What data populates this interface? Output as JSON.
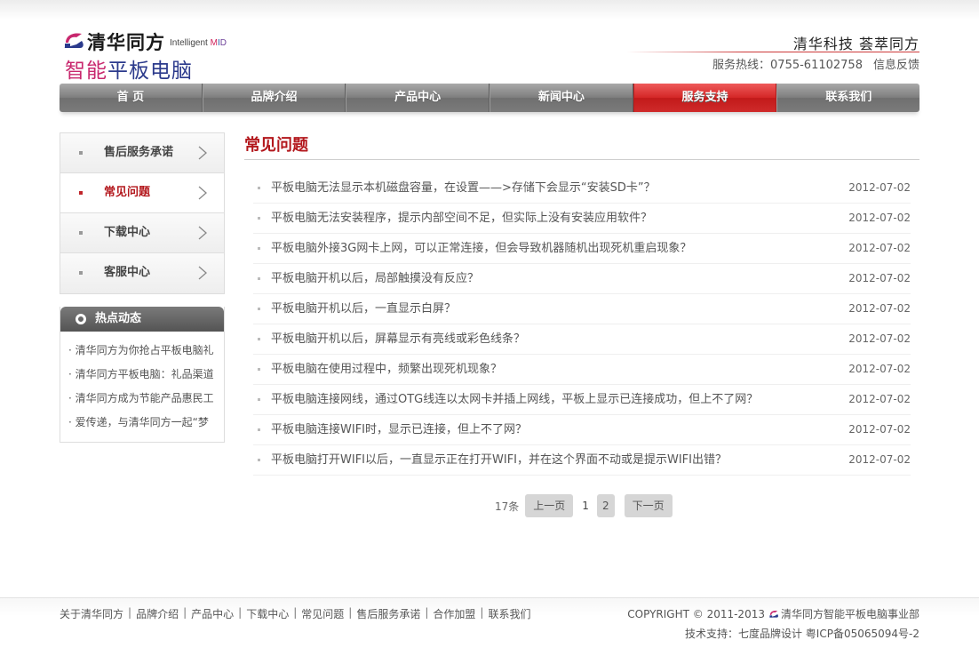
{
  "header": {
    "brand_name": "清华同方",
    "brand_english_prefix": "Intelligent ",
    "brand_english_m": "M",
    "brand_english_i": "I",
    "brand_english_d": "D",
    "product_accent": "智能",
    "product_rest": "平板电脑",
    "slogan": "清华科技  荟萃同方",
    "hotline": "服务热线：0755-61102758",
    "feedback": "信息反馈"
  },
  "nav": [
    {
      "label": "首 页"
    },
    {
      "label": "品牌介绍"
    },
    {
      "label": "产品中心"
    },
    {
      "label": "新闻中心"
    },
    {
      "label": "服务支持",
      "active": true
    },
    {
      "label": "联系我们"
    }
  ],
  "sidebar": {
    "items": [
      {
        "label": "售后服务承诺"
      },
      {
        "label": "常见问题",
        "active": true
      },
      {
        "label": "下载中心"
      },
      {
        "label": "客服中心"
      }
    ],
    "hot_title": "热点动态",
    "hot_items": [
      "· 清华同方为你抢占平板电脑礼",
      "· 清华同方平板电脑：礼品渠道",
      "· 清华同方成为节能产品惠民工",
      "· 爱传递，与清华同方一起“梦"
    ]
  },
  "main": {
    "title": "常见问题",
    "faq": [
      {
        "q": "平板电脑无法显示本机磁盘容量，在设置——>存储下会显示“安装SD卡”？",
        "date": "2012-07-02"
      },
      {
        "q": "平板电脑无法安装程序，提示内部空间不足，但实际上没有安装应用软件？",
        "date": "2012-07-02"
      },
      {
        "q": "平板电脑外接3G网卡上网，可以正常连接，但会导致机器随机出现死机重启现象？",
        "date": "2012-07-02"
      },
      {
        "q": "平板电脑开机以后，局部触摸没有反应？",
        "date": "2012-07-02"
      },
      {
        "q": "平板电脑开机以后，一直显示白屏？",
        "date": "2012-07-02"
      },
      {
        "q": "平板电脑开机以后，屏幕显示有亮线或彩色线条？",
        "date": "2012-07-02"
      },
      {
        "q": "平板电脑在使用过程中，频繁出现死机现象？",
        "date": "2012-07-02"
      },
      {
        "q": "平板电脑连接网线，通过OTG线连以太网卡并插上网线，平板上显示已连接成功，但上不了网？",
        "date": "2012-07-02"
      },
      {
        "q": "平板电脑连接WIFI时，显示已连接，但上不了网？",
        "date": "2012-07-02"
      },
      {
        "q": "平板电脑打开WIFI以后，一直显示正在打开WIFI，并在这个界面不动或是提示WIFI出错？",
        "date": "2012-07-02"
      }
    ],
    "pager": {
      "count": "17条",
      "prev": "上一页",
      "current": "1",
      "page2": "2",
      "next": "下一页"
    }
  },
  "footer": {
    "links": [
      "关于清华同方",
      "品牌介绍",
      "产品中心",
      "下载中心",
      "常见问题",
      "售后服务承诺",
      "合作加盟",
      "联系我们"
    ],
    "separator": "|",
    "copyright_prefix": "COPYRIGHT © 2011-2013",
    "copyright_suffix": "清华同方智能平板电脑事业部",
    "support": "技术支持：七度品牌设计  粤ICP备05065094号-2"
  },
  "colors": {
    "accent_red": "#c21a1a",
    "nav_gray": "#7d7d7d",
    "title_red": "#b3181d"
  },
  "icons": [
    "tongfang-logo-icon",
    "chevron-right-icon",
    "ring-icon"
  ]
}
